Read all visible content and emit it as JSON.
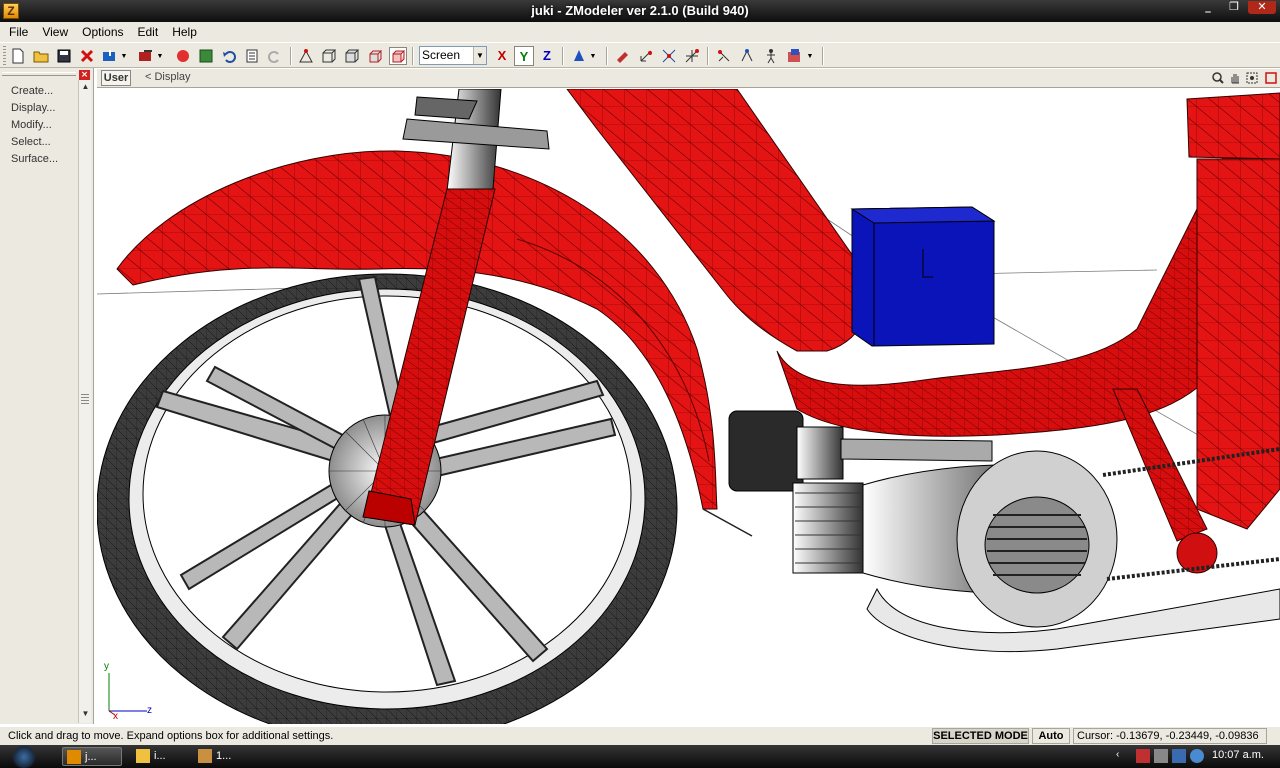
{
  "window": {
    "title": "juki - ZModeler ver 2.1.0 (Build 940)",
    "app_icon": "Z",
    "controls": [
      "_",
      "❐",
      "✕"
    ]
  },
  "menubar": {
    "items": [
      "File",
      "View",
      "Options",
      "Edit",
      "Help"
    ]
  },
  "toolbar": {
    "screen_select": "Screen",
    "axes": [
      "X",
      "Y",
      "Z"
    ],
    "axis_colors": {
      "X": "#c00000",
      "Y": "#008000",
      "Z": "#0000c0"
    }
  },
  "left_panel": {
    "commands": [
      "Create...",
      "Display...",
      "Modify...",
      "Select...",
      "Surface..."
    ]
  },
  "viewport_header": {
    "view_button": "User",
    "breadcrumb": "< Display",
    "icons": [
      "zoom-icon",
      "pan-hand-icon",
      "zoom-extents-icon",
      "maximize-viewport-icon"
    ]
  },
  "viewport": {
    "axis_labels": {
      "y": "y",
      "x": "x",
      "z": "z"
    },
    "colors": {
      "body": "#e01010",
      "cube": "#0a14b8",
      "tire": "#3a3a3a",
      "metal": "#cfcfcf"
    }
  },
  "statusbar": {
    "hint": "Click and drag to move. Expand options box for additional settings.",
    "mode": "SELECTED MODE",
    "auto": "Auto",
    "cursor": "Cursor: -0.13679, -0.23449, -0.09836"
  },
  "taskbar": {
    "tasks": [
      "j...",
      "i...",
      "1..."
    ],
    "clock": "10:07 a.m."
  }
}
